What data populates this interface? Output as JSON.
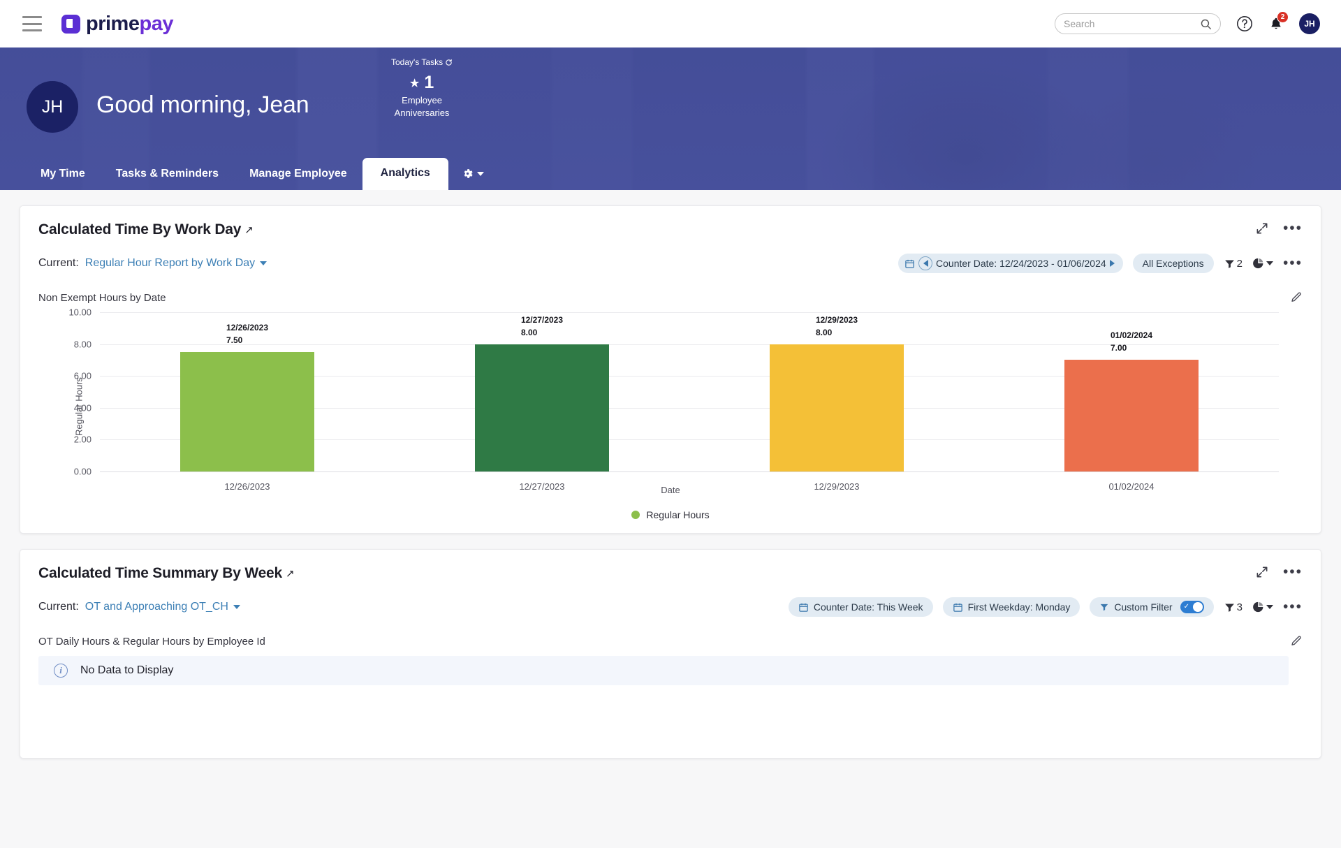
{
  "topbar": {
    "brand_primary": "prime",
    "brand_secondary": "pay",
    "search_placeholder": "Search",
    "search_value": "",
    "notification_count": "2",
    "avatar_initials": "JH"
  },
  "hero": {
    "avatar_initials": "JH",
    "greeting": "Good morning, Jean",
    "tasks_title": "Today's Tasks",
    "tasks_count": "1",
    "tasks_label_line1": "Employee",
    "tasks_label_line2": "Anniversaries",
    "tabs": [
      {
        "label": "My Time",
        "active": false
      },
      {
        "label": "Tasks & Reminders",
        "active": false
      },
      {
        "label": "Manage Employee",
        "active": false
      },
      {
        "label": "Analytics",
        "active": true
      }
    ]
  },
  "card1": {
    "title": "Calculated Time By Work Day",
    "external_arrow": "↗",
    "current_label": "Current:",
    "current_value": "Regular Hour Report by Work Day",
    "date_chip": "Counter Date: 12/24/2023 - 01/06/2024",
    "exceptions_chip": "All Exceptions",
    "filter_count": "2",
    "chart_subtitle": "Non Exempt Hours by Date"
  },
  "card2": {
    "title": "Calculated Time Summary By Week",
    "external_arrow": "↗",
    "current_label": "Current:",
    "current_value": "OT and Approaching OT_CH",
    "chip_counter_date": "Counter Date: This Week",
    "chip_first_weekday": "First Weekday: Monday",
    "chip_custom_filter": "Custom Filter",
    "filter_count": "3",
    "chart_subtitle": "OT Daily Hours & Regular Hours by Employee Id",
    "no_data_text": "No Data to Display"
  },
  "chart_data": {
    "type": "bar",
    "title": "Non Exempt Hours by Date",
    "xlabel": "Date",
    "ylabel": "Regular Hours",
    "ylim": [
      0,
      10
    ],
    "yticks": [
      "0.00",
      "2.00",
      "4.00",
      "6.00",
      "8.00",
      "10.00"
    ],
    "grid": true,
    "legend_position": "bottom",
    "legend": [
      "Regular Hours"
    ],
    "legend_color": "#8cbf4b",
    "categories": [
      "12/26/2023",
      "12/27/2023",
      "12/29/2023",
      "01/02/2024"
    ],
    "values": [
      7.5,
      8.0,
      8.0,
      7.0
    ],
    "value_labels": [
      "7.50",
      "8.00",
      "8.00",
      "7.00"
    ],
    "colors": [
      "#8cbf4b",
      "#2f7a45",
      "#f4c037",
      "#eb6f4c"
    ]
  }
}
